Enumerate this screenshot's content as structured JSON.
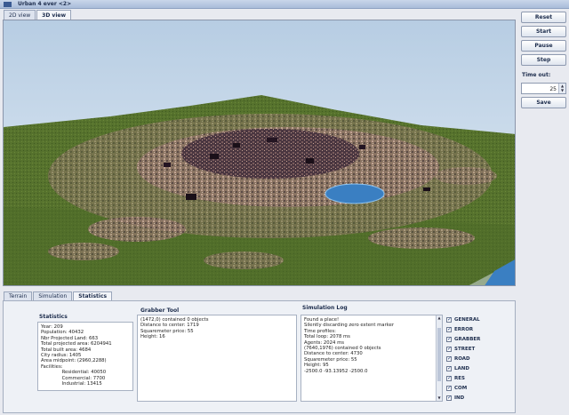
{
  "window": {
    "title": "Urban 4 ever <2>"
  },
  "view_tabs": [
    {
      "label": "2D view"
    },
    {
      "label": "3D view"
    }
  ],
  "sidebar": {
    "buttons": {
      "reset": "Reset",
      "start": "Start",
      "pause": "Pause",
      "step": "Step",
      "save": "Save"
    },
    "timeout_label": "Time out:",
    "timeout_value": "25"
  },
  "bottom_tabs": [
    {
      "label": "Terrain"
    },
    {
      "label": "Simulation"
    },
    {
      "label": "Statistics"
    }
  ],
  "statistics": {
    "title": "Statistics",
    "lines": [
      "Year: 209",
      "Population: 40432",
      "Nbr Projected Land: 663",
      "Total projected area: 6204941",
      "Total built area: 4684",
      "City radius: 1405",
      "Area midpoint: (2960,2288)",
      "Facilities:",
      "              Residential: 40050",
      "              Commercial: 7700",
      "              Industrial: 13415"
    ]
  },
  "grabber": {
    "title": "Grabber Tool",
    "lines": [
      "(1472,0) contained 0 objects",
      "Distance to center: 1719",
      "Squaremeter price: 55",
      "Height: 16"
    ]
  },
  "simlog": {
    "title": "Simulation Log",
    "lines": [
      "Found a place!",
      "",
      "Silently discarding zero extent marker",
      "",
      "Time profiles:",
      "Total loop: 2078 ms",
      "Agents: 2024 ms",
      "",
      "(7640,1976) contained 0 objects",
      "Distance to center: 4730",
      "Squaremeter price: 55",
      "Height: 95",
      "",
      "-2500.0 -93.13952 -2500.0"
    ]
  },
  "log_filters": [
    {
      "label": "GENERAL"
    },
    {
      "label": "ERROR"
    },
    {
      "label": "GRABBER"
    },
    {
      "label": "STREET"
    },
    {
      "label": "ROAD"
    },
    {
      "label": "LAND"
    },
    {
      "label": "RES"
    },
    {
      "label": "COM"
    },
    {
      "label": "IND"
    }
  ],
  "colors": {
    "sky": "#c2d6ea",
    "terrain": "#4f6e2a",
    "water": "#3a7fc2",
    "accent": "#1c2c4c"
  }
}
